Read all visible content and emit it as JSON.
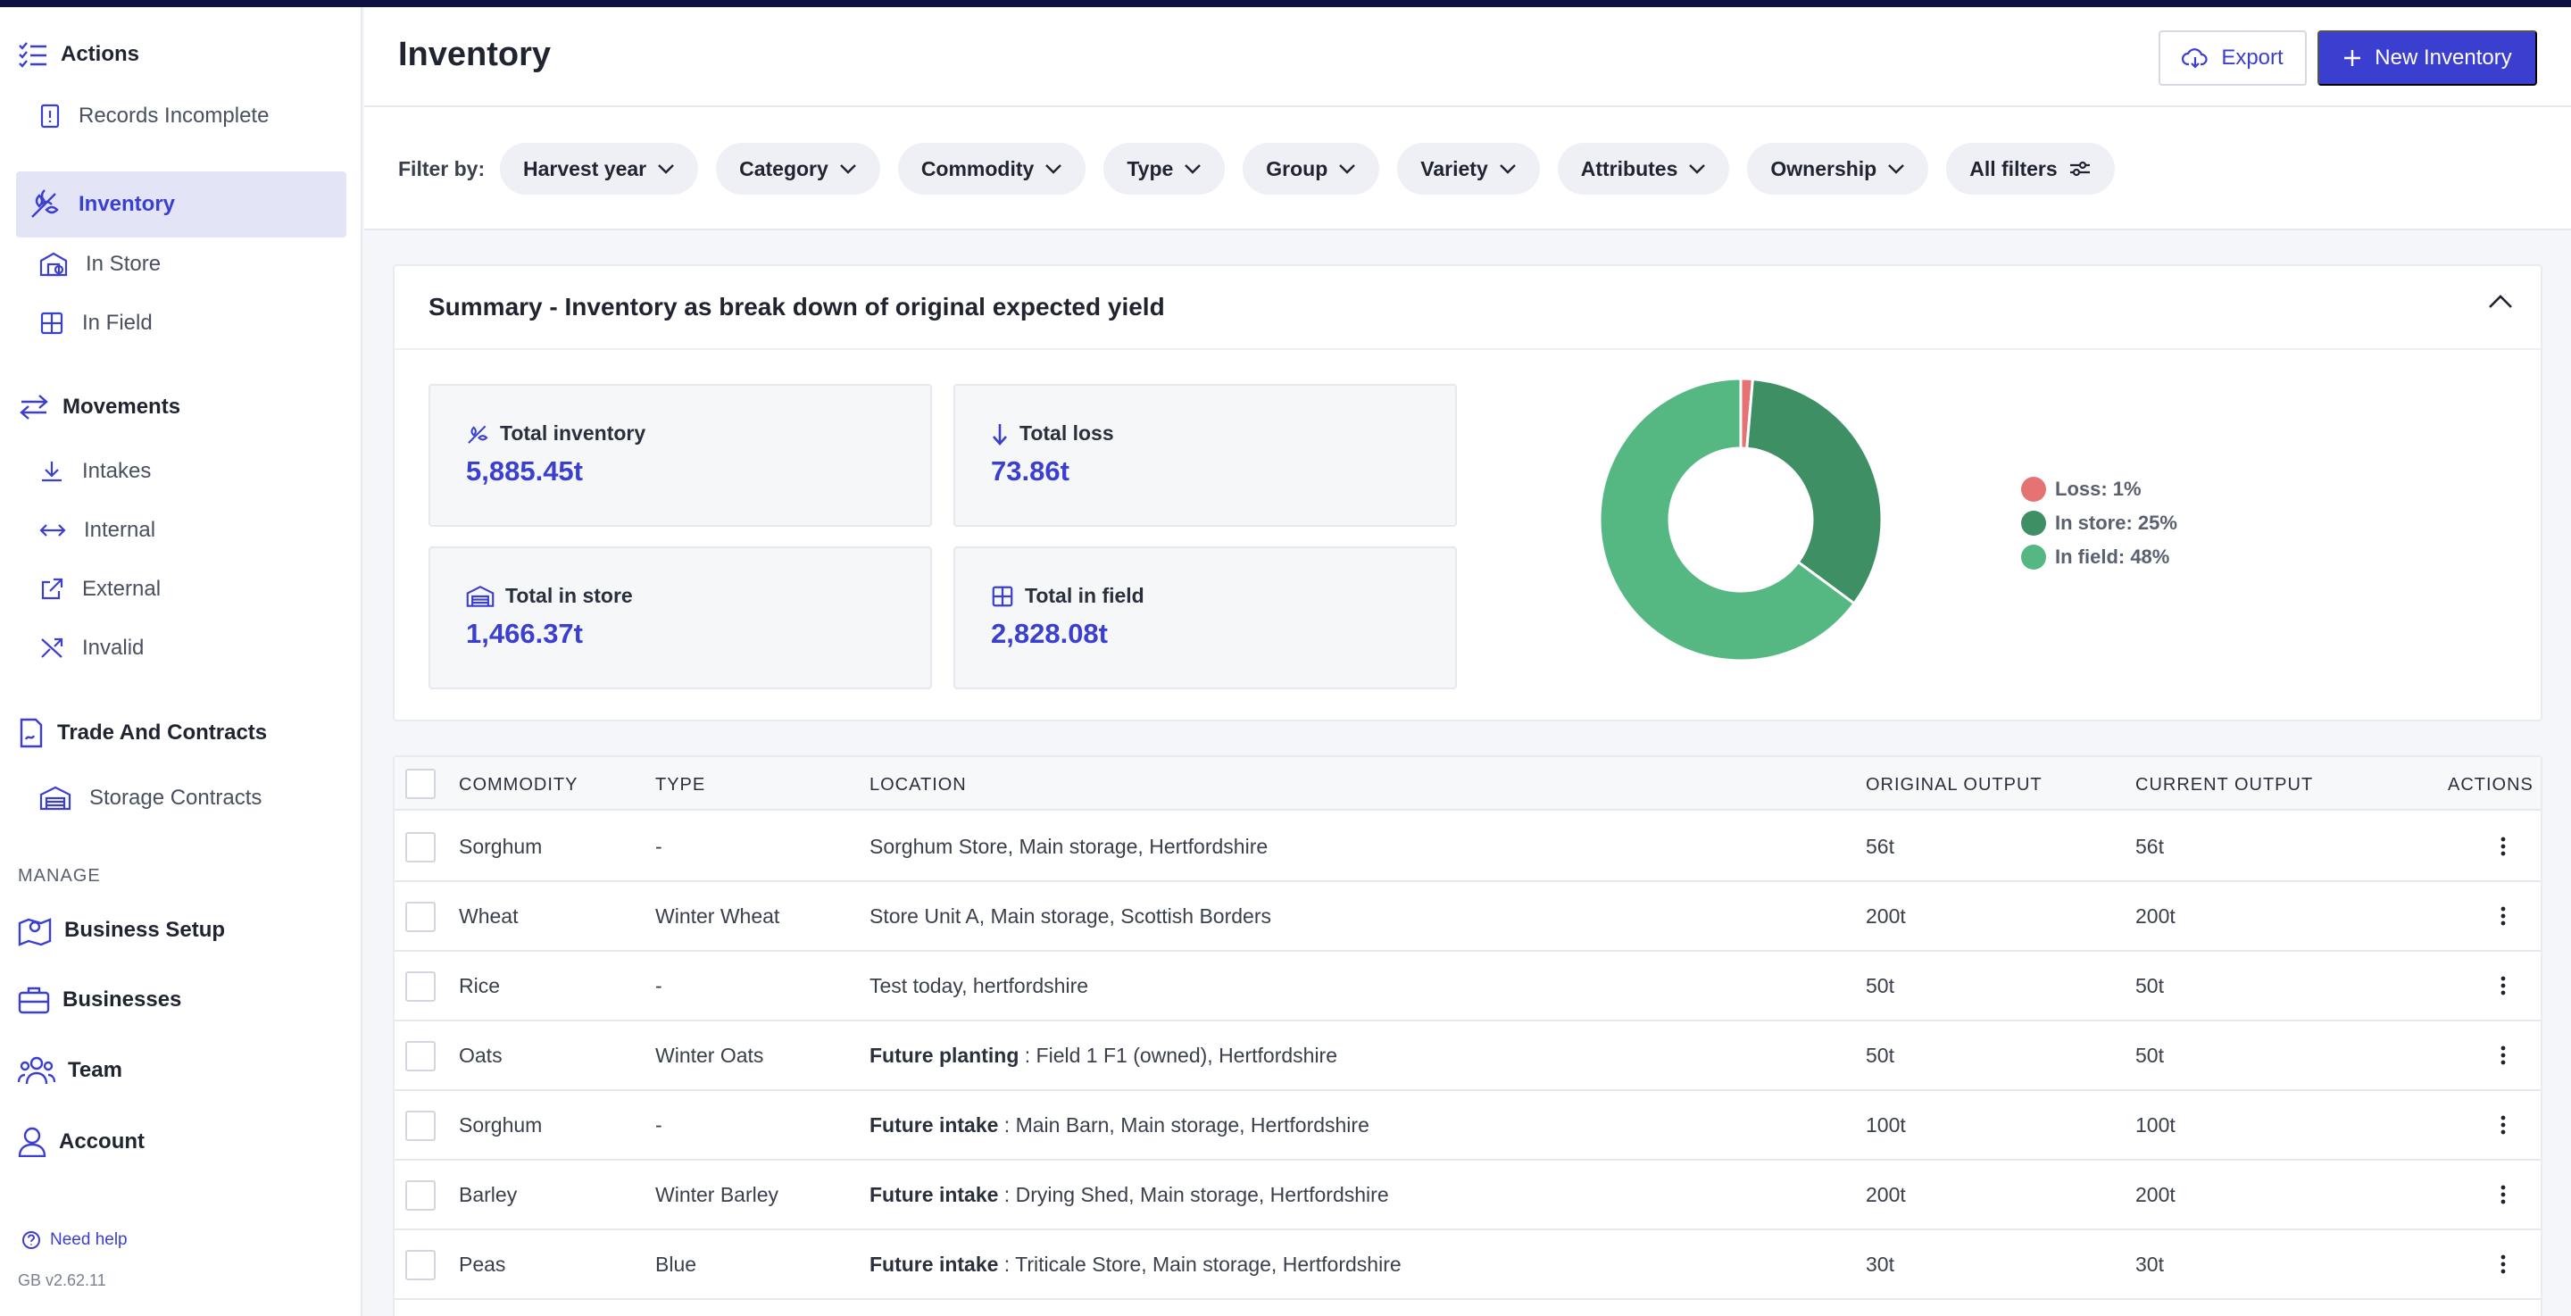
{
  "sidebar": {
    "actions": "Actions",
    "records_incomplete": "Records Incomplete",
    "inventory": "Inventory",
    "in_store": "In Store",
    "in_field": "In Field",
    "movements": "Movements",
    "intakes": "Intakes",
    "internal": "Internal",
    "external": "External",
    "invalid": "Invalid",
    "trade": "Trade And Contracts",
    "storage_contracts": "Storage Contracts",
    "manage": "MANAGE",
    "business_setup": "Business Setup",
    "businesses": "Businesses",
    "team": "Team",
    "account": "Account",
    "help": "Need help",
    "version": "GB v2.62.11"
  },
  "header": {
    "title": "Inventory",
    "export": "Export",
    "new_inventory": "New Inventory"
  },
  "filters": {
    "label": "Filter by:",
    "chips": [
      "Harvest year",
      "Category",
      "Commodity",
      "Type",
      "Group",
      "Variety",
      "Attributes",
      "Ownership",
      "All filters"
    ]
  },
  "summary": {
    "title": "Summary - Inventory as break down of original expected yield",
    "total_inventory_label": "Total inventory",
    "total_inventory": "5,885.45t",
    "total_loss_label": "Total loss",
    "total_loss": "73.86t",
    "total_store_label": "Total in store",
    "total_store": "1,466.37t",
    "total_field_label": "Total in field",
    "total_field": "2,828.08t",
    "legend": [
      "Loss: 1%",
      "In store: 25%",
      "In field: 48%"
    ]
  },
  "chart_data": {
    "type": "pie",
    "categories": [
      "Loss",
      "In store",
      "In field"
    ],
    "values": [
      1,
      25,
      48
    ],
    "colors": [
      "#e57373",
      "#3f8f65",
      "#55b882"
    ]
  },
  "colors": {
    "accent": "#3b3fd0",
    "loss": "#e57373",
    "store": "#3f8f65",
    "field": "#55b882"
  },
  "table": {
    "headers": [
      "COMMODITY",
      "TYPE",
      "LOCATION",
      "ORIGINAL OUTPUT",
      "CURRENT OUTPUT",
      "ACTIONS"
    ],
    "rows": [
      {
        "commodity": "Sorghum",
        "type": "-",
        "prefix": "",
        "location": "Sorghum Store, Main storage, Hertfordshire",
        "original": "56t",
        "current": "56t"
      },
      {
        "commodity": "Wheat",
        "type": "Winter Wheat",
        "prefix": "",
        "location": "Store Unit A, Main storage, Scottish Borders",
        "original": "200t",
        "current": "200t"
      },
      {
        "commodity": "Rice",
        "type": "-",
        "prefix": "",
        "location": "Test today, hertfordshire",
        "original": "50t",
        "current": "50t"
      },
      {
        "commodity": "Oats",
        "type": "Winter Oats",
        "prefix": "Future planting",
        "location": " : Field 1 F1 (owned), Hertfordshire",
        "original": "50t",
        "current": "50t"
      },
      {
        "commodity": "Sorghum",
        "type": "-",
        "prefix": "Future intake",
        "location": " : Main Barn, Main storage, Hertfordshire",
        "original": "100t",
        "current": "100t"
      },
      {
        "commodity": "Barley",
        "type": "Winter Barley",
        "prefix": "Future intake",
        "location": " : Drying Shed, Main storage, Hertfordshire",
        "original": "200t",
        "current": "200t"
      },
      {
        "commodity": "Peas",
        "type": "Blue",
        "prefix": "Future intake",
        "location": " : Triticale Store, Main storage, Hertfordshire",
        "original": "30t",
        "current": "30t"
      }
    ]
  }
}
